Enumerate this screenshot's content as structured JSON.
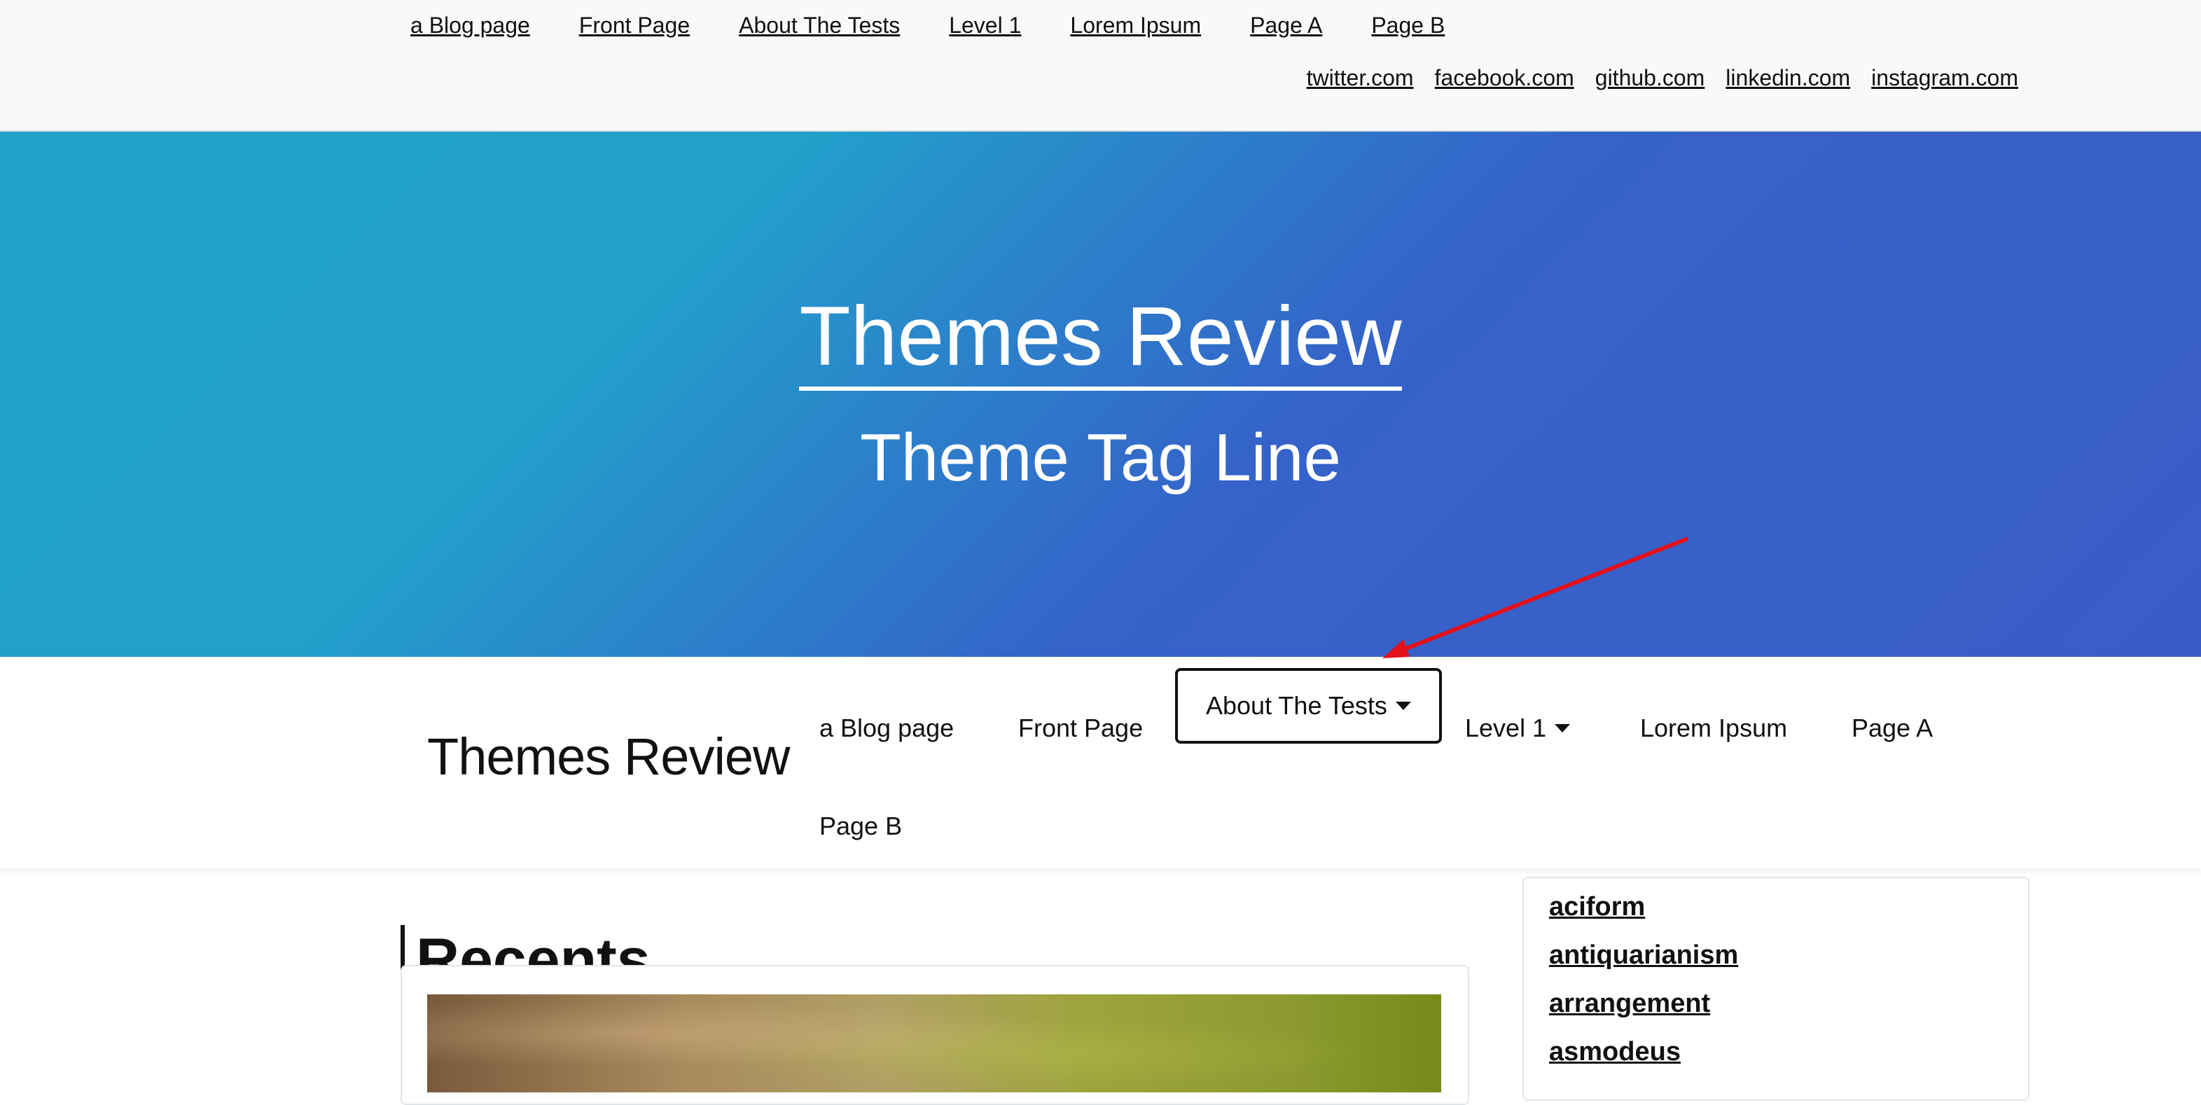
{
  "top_nav": {
    "items": [
      {
        "label": "a Blog page"
      },
      {
        "label": "Front Page"
      },
      {
        "label": "About The Tests"
      },
      {
        "label": "Level 1"
      },
      {
        "label": "Lorem Ipsum"
      },
      {
        "label": "Page A"
      },
      {
        "label": "Page B"
      }
    ]
  },
  "social_nav": {
    "items": [
      {
        "label": "twitter.com"
      },
      {
        "label": "facebook.com"
      },
      {
        "label": "github.com"
      },
      {
        "label": "linkedin.com"
      },
      {
        "label": "instagram.com"
      }
    ]
  },
  "hero": {
    "title": "Themes Review",
    "tagline": "Theme Tag Line",
    "gradient_start": "#22a3cc",
    "gradient_end": "#3a5cc8",
    "annotation_arrow_color": "#e3101a"
  },
  "main_nav": {
    "brand": "Themes Review",
    "items": [
      {
        "label": "a Blog page"
      },
      {
        "label": "Front Page"
      },
      {
        "label": "About The Tests",
        "has_dropdown": true,
        "focused": true
      },
      {
        "label": "Level 1",
        "has_dropdown": true
      },
      {
        "label": "Lorem Ipsum"
      },
      {
        "label": "Page A"
      },
      {
        "label": "Page B"
      }
    ]
  },
  "content": {
    "section_title": "Recents"
  },
  "sidebar": {
    "tags": [
      {
        "label": "aciform"
      },
      {
        "label": "antiquarianism"
      },
      {
        "label": "arrangement"
      },
      {
        "label": "asmodeus"
      }
    ]
  }
}
